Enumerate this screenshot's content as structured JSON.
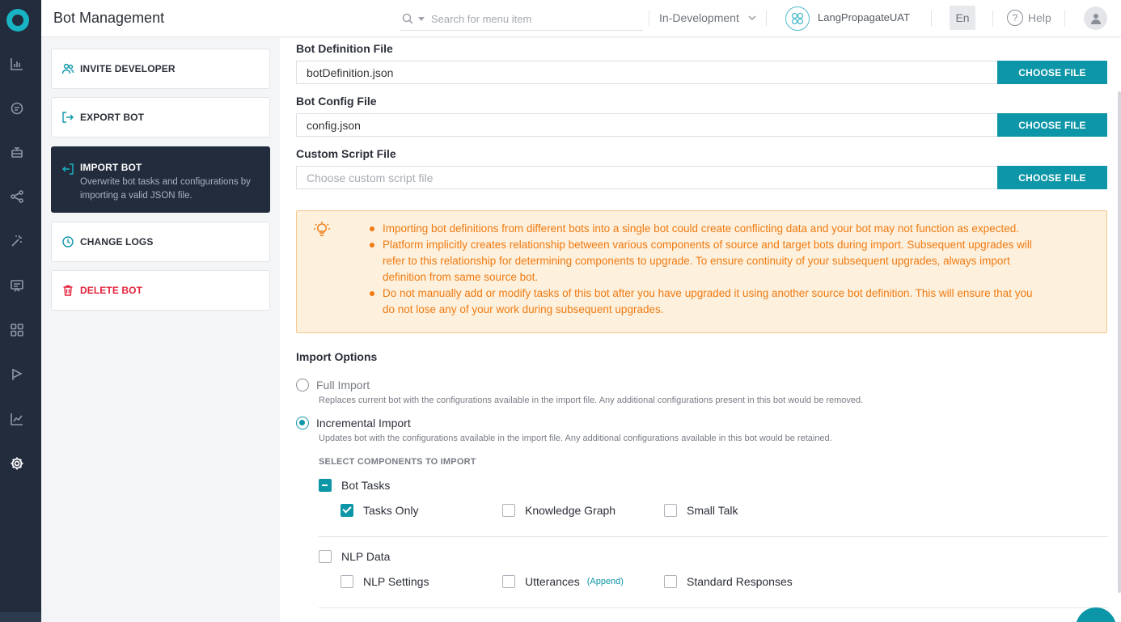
{
  "header": {
    "title": "Bot Management",
    "search_placeholder": "Search for menu item",
    "environment": "In-Development",
    "bot_name": "LangPropagateUAT",
    "language": "En",
    "help": "Help"
  },
  "rail_icons": [
    "analytics-icon",
    "conversation-icon",
    "bot-builder-icon",
    "flows-icon",
    "magic-icon",
    "channels-icon",
    "apps-icon",
    "deploy-icon",
    "insights-icon",
    "settings-icon"
  ],
  "side_menu": {
    "invite": "INVITE DEVELOPER",
    "export": "EXPORT BOT",
    "import": "IMPORT BOT",
    "import_desc": "Overwrite bot tasks and configurations by importing a valid JSON file.",
    "change_logs": "CHANGE LOGS",
    "delete": "DELETE BOT"
  },
  "files": {
    "definition_label": "Bot Definition File",
    "definition_value": "botDefinition.json",
    "config_label": "Bot Config File",
    "config_value": "config.json",
    "script_label": "Custom Script File",
    "script_placeholder": "Choose custom script file",
    "choose_label": "CHOOSE FILE"
  },
  "notes": [
    "Importing bot definitions from different bots into a single bot could create conflicting data and your bot may not function as expected.",
    "Platform implicitly creates relationship between various components of source and target bots during import. Subsequent upgrades will refer to this relationship for determining components to upgrade. To ensure continuity of your subsequent upgrades, always import definition from same source bot.",
    "Do not manually add or modify tasks of this bot after you have upgraded it using another source bot definition. This will ensure that you do not lose any of your work during subsequent upgrades."
  ],
  "import_options": {
    "heading": "Import Options",
    "full_label": "Full Import",
    "full_desc": "Replaces current bot with the configurations available in the import file. Any additional configurations present in this bot would be removed.",
    "incremental_label": "Incremental Import",
    "incremental_desc": "Updates bot with the configurations available in the import file. Any additional configurations available in this bot would be retained.",
    "components_heading": "SELECT COMPONENTS TO IMPORT",
    "bot_tasks": "Bot Tasks",
    "tasks_only": "Tasks Only",
    "knowledge_graph": "Knowledge Graph",
    "small_talk": "Small Talk",
    "nlp_data": "NLP Data",
    "nlp_settings": "NLP Settings",
    "utterances": "Utterances",
    "append": "(Append)",
    "standard_responses": "Standard Responses"
  },
  "colors": {
    "accent": "#0d96a8",
    "rail": "#222c3d",
    "warning": "#ef7b12",
    "danger": "#e3223a"
  }
}
